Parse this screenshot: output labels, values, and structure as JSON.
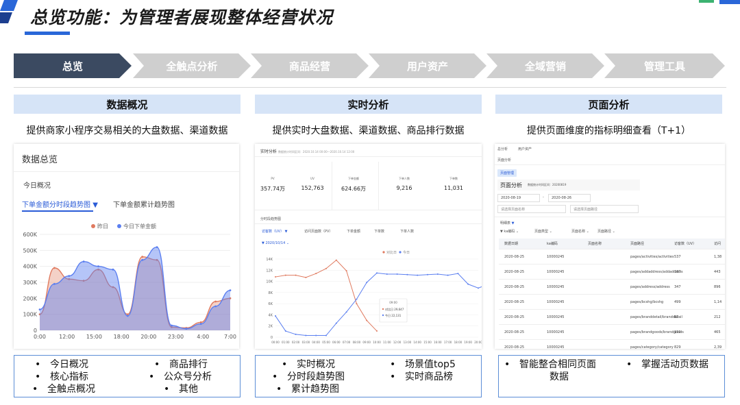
{
  "title": "总览功能：为管理者展现整体经营状况",
  "steps": [
    "总览",
    "全触点分析",
    "商品经营",
    "用户资产",
    "全域营销",
    "管理工具"
  ],
  "colors": {
    "active_step": "#3b4a61",
    "inactive_step": "#cfcfcf",
    "header_bg": "#d6e4f7",
    "accent": "#2a5bd7",
    "line_orange": "#e07a5f",
    "line_blue": "#5b7ff0"
  },
  "columns": [
    {
      "heading": "数据概况",
      "desc": "提供商家小程序交易相关的大盘数据、渠道数据"
    },
    {
      "heading": "实时分析",
      "desc": "提供实时大盘数据、渠道数据、商品排行数据"
    },
    {
      "heading": "页面分析",
      "desc": "提供页面维度的指标明细查看（T+1）"
    }
  ],
  "panel1": {
    "title": "数据总览",
    "subtitle": "今日概况",
    "tab_active": "下单金额分时段趋势图",
    "tab_inactive": "下单金额累计趋势图",
    "legend": [
      "昨日",
      "今日下单金额"
    ],
    "chart_data": {
      "type": "area",
      "x": [
        "0:00",
        "12:00",
        "15:00",
        "18:00",
        "20:00",
        "23:00",
        "4:00",
        "7:00"
      ],
      "y_ticks": [
        "0",
        "100K",
        "200K",
        "300K",
        "400K",
        "500K",
        "600K"
      ],
      "ylim": [
        0,
        600000
      ],
      "series": [
        {
          "name": "昨日",
          "values": [
            100000,
            390000,
            320000,
            310000,
            380000,
            270000,
            100000,
            460000,
            440000,
            20000,
            15000,
            50000,
            180000,
            200000
          ]
        },
        {
          "name": "今日下单金额",
          "values": [
            130000,
            290000,
            340000,
            430000,
            400000,
            380000,
            90000,
            440000,
            520000,
            30000,
            10000,
            40000,
            150000,
            250000
          ]
        }
      ]
    }
  },
  "panel2": {
    "title": "实时分析",
    "title_note": "数据统计时间区间：2020.10.14 00:00—2020.10.14 12:00",
    "kpis": [
      {
        "label": "PV",
        "value": "357.74万"
      },
      {
        "label": "UV",
        "value": "152,763"
      },
      {
        "label": "下单金额",
        "value": "624.66万"
      },
      {
        "label": "下单人数",
        "value": "9,216"
      },
      {
        "label": "下单数",
        "value": "11,031"
      }
    ],
    "trend_title": "分时段趋势图",
    "tabs": [
      "访客数（UV）",
      "访问页面数（PV）",
      "下单金额",
      "下单数",
      "下单人数"
    ],
    "date": "2020/10/14",
    "legend": [
      "对比日",
      "今日"
    ],
    "tooltip": {
      "time": "09:00",
      "a_label": "对比日",
      "a_value": "29,647",
      "b_label": "今日",
      "b_value": "22,131"
    },
    "chart_data": {
      "type": "line",
      "y_ticks": [
        "0",
        "2K",
        "4K",
        "6K",
        "8K",
        "10K",
        "12K",
        "14K"
      ],
      "x": [
        "00:00",
        "01:00",
        "02:00",
        "03:00",
        "04:00",
        "05:00",
        "06:00",
        "07:00",
        "08:00",
        "09:00",
        "10:00",
        "11:00",
        "12:00",
        "13:00",
        "14:00",
        "15:00",
        "16:00",
        "17:00",
        "18:00",
        "19:00",
        "20:00"
      ],
      "series": [
        {
          "name": "对比日",
          "values": [
            10800,
            11100,
            11100,
            10700,
            11400,
            12300,
            13800,
            11900,
            6000,
            3000,
            1100
          ]
        },
        {
          "name": "今日",
          "values": [
            3800,
            1100,
            500,
            300,
            300,
            300,
            2500,
            4500,
            6800,
            9800,
            11500,
            11300,
            11300,
            11200,
            11100,
            11200,
            11300,
            11100,
            11400,
            9500,
            8800,
            9500
          ]
        }
      ]
    }
  },
  "panel3": {
    "nav": [
      "总分析",
      "用户资产"
    ],
    "crumb": "页面分析",
    "tag": "页面管理",
    "title": "页面分析",
    "title_note": "数据统计时间区间：20200819",
    "date_from": "2020-08-19",
    "date_to": "2020-08-26",
    "filter1": "请选择页面名称",
    "filter2": "请选择页面路径",
    "detail": "明细表",
    "filters": [
      "ka编码",
      "页面类型",
      "页面名称",
      "页面路径"
    ],
    "headers": [
      "数据日期",
      "ka编码",
      "页面名称",
      "页面路径",
      "访客数（UV）",
      "访问"
    ],
    "rows": [
      [
        "2020-08-25",
        "10000245",
        "",
        "pages/activities/activities",
        "537",
        "1,38"
      ],
      [
        "2020-08-25",
        "10000245",
        "",
        "pages/addaddress/addaddress",
        "187",
        "443"
      ],
      [
        "2020-08-25",
        "10000245",
        "",
        "pages/address/address",
        "347",
        "896"
      ],
      [
        "2020-08-25",
        "10000245",
        "",
        "pages/bcshg/bcshg",
        "499",
        "1,14"
      ],
      [
        "2020-08-25",
        "10000245",
        "",
        "pages/branddetail/branddetail",
        "82",
        "212"
      ],
      [
        "2020-08-25",
        "10000245",
        "",
        "pages/brandgoods/brandgoods",
        "159",
        "465"
      ],
      [
        "2020-08-25",
        "10000245",
        "",
        "pages/category/category",
        "829",
        "2,39"
      ]
    ]
  },
  "bottom": [
    {
      "items": [
        "今日概况",
        "核心指标",
        "全触点概况",
        "商品排行",
        "公众号分析",
        "其他"
      ]
    },
    {
      "items": [
        "实时概况",
        "分时段趋势图",
        "累计趋势图",
        "场景值top5",
        "实时商品榜"
      ]
    },
    {
      "items": [
        "智能整合相同页面",
        "数据",
        "掌握活动页数据"
      ]
    }
  ]
}
